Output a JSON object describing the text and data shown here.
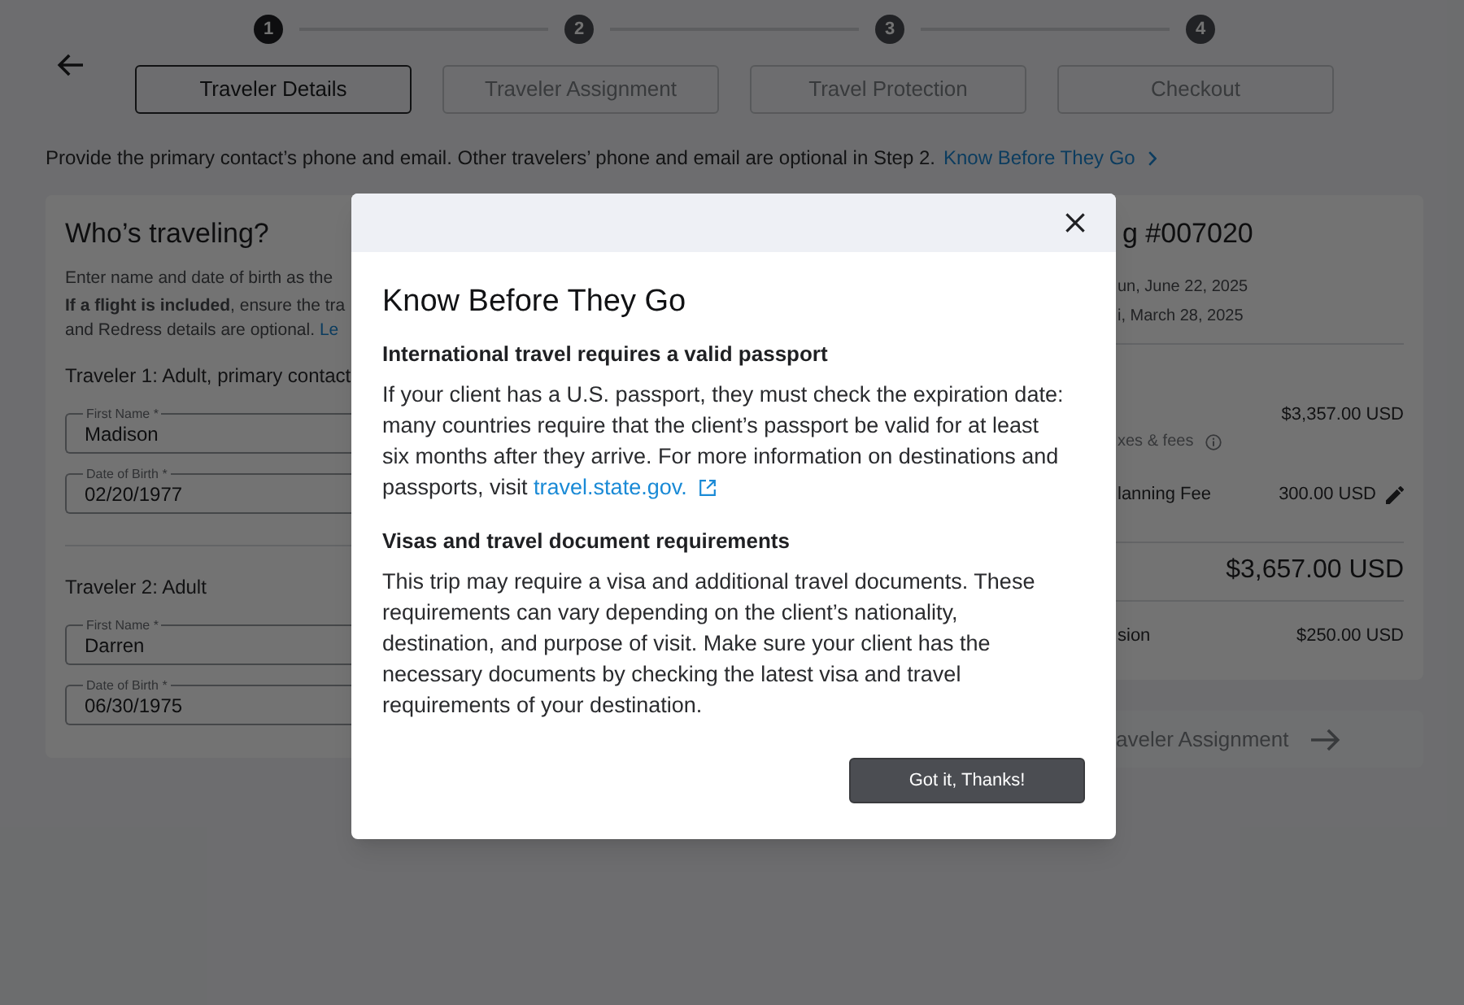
{
  "stepper": [
    {
      "number": "1",
      "selected": true
    },
    {
      "number": "2",
      "selected": false
    },
    {
      "number": "3",
      "selected": false
    },
    {
      "number": "4",
      "selected": false
    }
  ],
  "tabs": [
    {
      "label": "Traveler Details",
      "selected": true
    },
    {
      "label": "Traveler Assignment",
      "selected": false
    },
    {
      "label": "Travel Protection",
      "selected": false
    },
    {
      "label": "Checkout",
      "selected": false
    }
  ],
  "notice": {
    "text": "Provide the primary contact’s phone and email. Other travelers’ phone and email are optional in Step 2.",
    "link": "Know Before They Go"
  },
  "travelers_card": {
    "title": "Who’s traveling?",
    "intro": "Enter name and date of birth as the",
    "flight_note": "**If a flight is included**, ensure the tra",
    "optional_note": "and Redress details are optional.",
    "optional_link": "Le",
    "travelers": [
      {
        "heading": "Traveler 1: Adult, primary contact",
        "fields": [
          {
            "label": "First Name *",
            "value": "Madison"
          },
          {
            "label": "Date of Birth *",
            "value": "02/20/1977"
          }
        ]
      },
      {
        "heading": "Traveler 2: Adult",
        "fields": [
          {
            "label": "First Name *",
            "value": "Darren"
          },
          {
            "label": "Date of Birth *",
            "value": "06/30/1975"
          }
        ]
      }
    ]
  },
  "summary_card": {
    "title": "g #007020",
    "dates": [
      "un, June 22, 2025",
      "i, March 28, 2025"
    ],
    "lines": [
      {
        "kind": "amount",
        "value": "$3,357.00 USD"
      },
      {
        "kind": "note",
        "label": "xes & fees"
      },
      {
        "kind": "fee",
        "label": "lanning Fee",
        "value": "300.00 USD"
      },
      {
        "kind": "total",
        "value": "$3,657.00 USD"
      },
      {
        "kind": "line",
        "label": "sion",
        "value": "$250.00 USD"
      }
    ]
  },
  "next_button": {
    "label": "aveler Assignment",
    "disabled": true
  },
  "modal": {
    "title": "Know Before They Go",
    "sections": [
      {
        "heading": "International travel requires a valid passport",
        "text": "If your client has a U.S. passport, they must check the expiration date: many countries require that the client’s passport be valid for at least six months after they arrive. For more information on destinations and passports, visit",
        "link": "travel.state.gov."
      },
      {
        "heading": "Visas and travel document requirements",
        "text": "This trip may require a visa and additional travel documents. These requirements can vary depending on the client’s nationality, destination, and purpose of visit. Make sure your client has the necessary documents by checking the latest visa and travel requirements of your destination."
      }
    ],
    "button": "Got it, Thanks!"
  }
}
